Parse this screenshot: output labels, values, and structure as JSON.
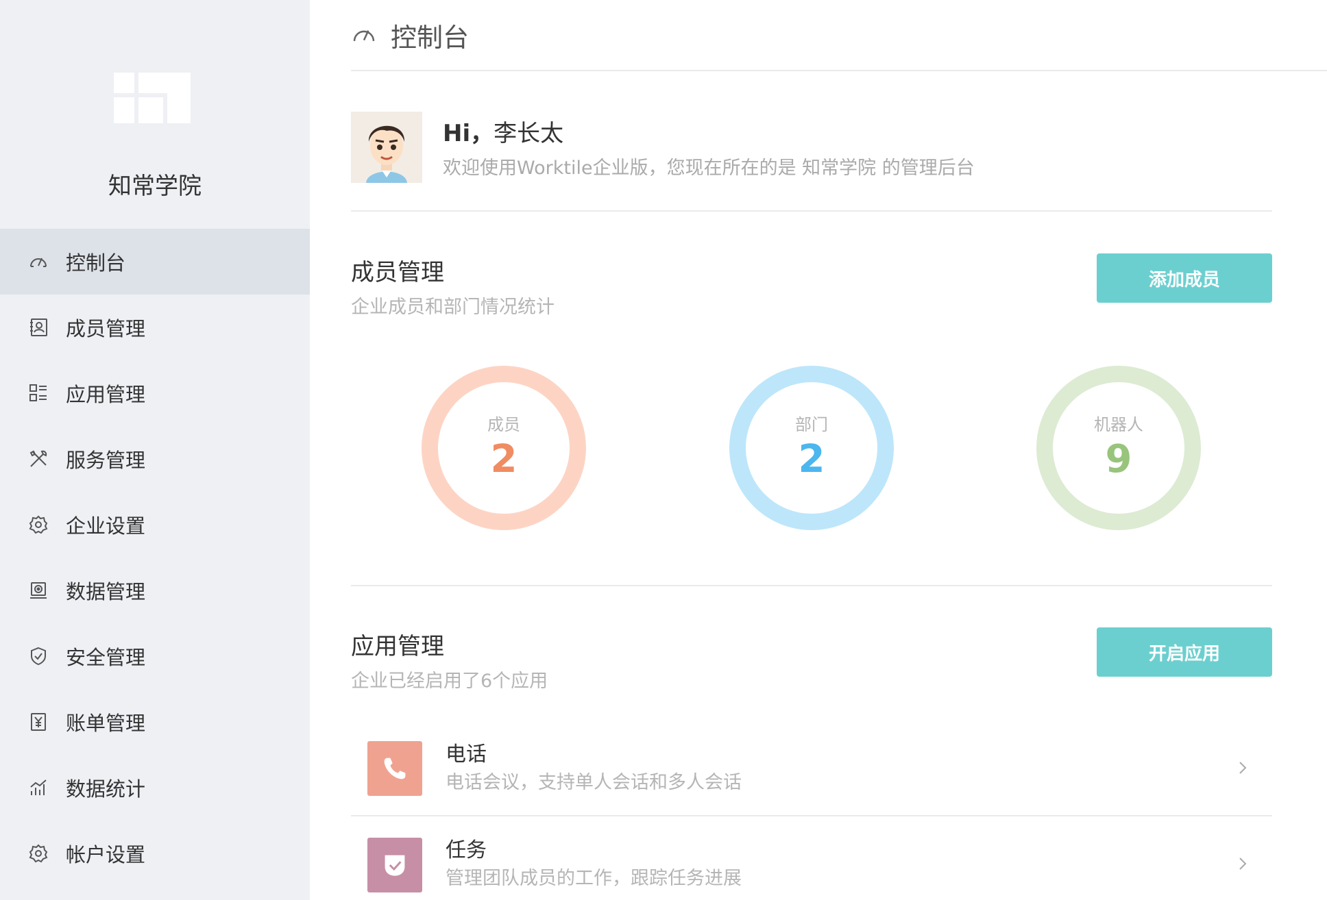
{
  "sidebar": {
    "org_name": "知常学院",
    "items": [
      {
        "label": "控制台",
        "icon": "dashboard-gauge-icon",
        "active": true
      },
      {
        "label": "成员管理",
        "icon": "member-card-icon",
        "active": false
      },
      {
        "label": "应用管理",
        "icon": "app-list-icon",
        "active": false
      },
      {
        "label": "服务管理",
        "icon": "tools-icon",
        "active": false
      },
      {
        "label": "企业设置",
        "icon": "gear-icon",
        "active": false
      },
      {
        "label": "数据管理",
        "icon": "data-drive-icon",
        "active": false
      },
      {
        "label": "安全管理",
        "icon": "shield-icon",
        "active": false
      },
      {
        "label": "账单管理",
        "icon": "bill-yen-icon",
        "active": false
      },
      {
        "label": "数据统计",
        "icon": "stats-chart-icon",
        "active": false
      },
      {
        "label": "帐户设置",
        "icon": "account-gear-icon",
        "active": false
      }
    ]
  },
  "header": {
    "title": "控制台",
    "icon": "dashboard-gauge-icon"
  },
  "welcome": {
    "greeting": "Hi，",
    "user_name": "李长太",
    "message": "欢迎使用Worktile企业版，您现在所在的是 知常学院 的管理后台"
  },
  "members": {
    "title": "成员管理",
    "subtitle": "企业成员和部门情况统计",
    "button_label": "添加成员",
    "stats": [
      {
        "label": "成员",
        "value": "2",
        "ring_color": "#fdd4c4",
        "text_color": "#f08c62"
      },
      {
        "label": "部门",
        "value": "2",
        "ring_color": "#bde6fa",
        "text_color": "#4cb6ee"
      },
      {
        "label": "机器人",
        "value": "9",
        "ring_color": "#dcebd2",
        "text_color": "#98c47c"
      }
    ]
  },
  "apps": {
    "title": "应用管理",
    "subtitle": "企业已经启用了6个应用",
    "button_label": "开启应用",
    "items": [
      {
        "name": "电话",
        "desc": "电话会议，支持单人会话和多人会话",
        "icon": "phone-icon",
        "color": "#f0a291"
      },
      {
        "name": "任务",
        "desc": "管理团队成员的工作，跟踪任务进展",
        "icon": "task-check-icon",
        "color": "#c68fa6"
      }
    ]
  },
  "colors": {
    "accent": "#6ccfcf",
    "sidebar_bg": "#eef0f4",
    "sidebar_active": "#dde1e8"
  }
}
